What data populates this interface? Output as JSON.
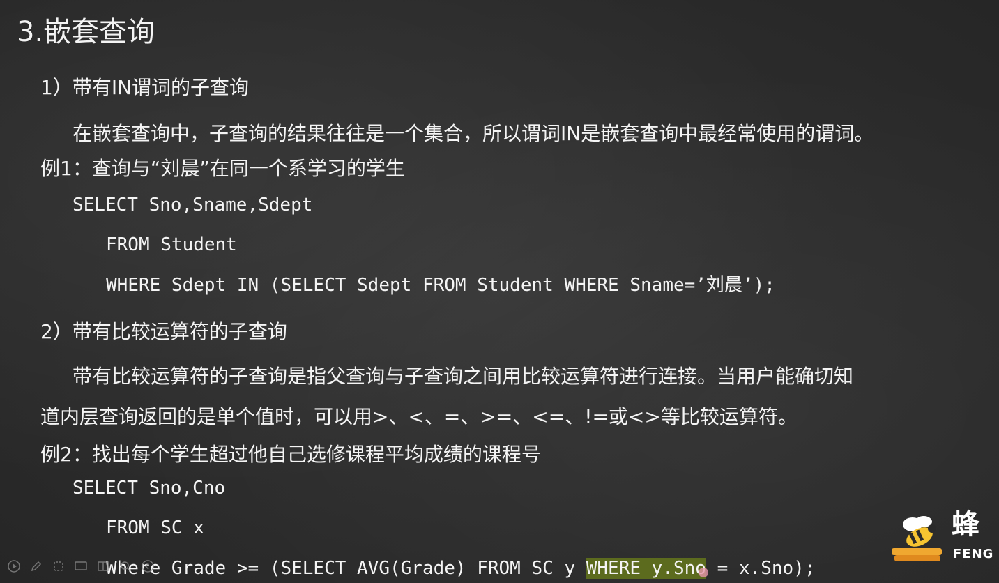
{
  "slide": {
    "title": "3.嵌套查询",
    "section1_heading": "1）带有IN谓词的子查询",
    "section1_desc": "在嵌套查询中，子查询的结果往往是一个集合，所以谓词IN是嵌套查询中最经常使用的谓词。",
    "example1_title": "例1：查询与“刘晨”在同一个系学习的学生",
    "example1_code": [
      "SELECT Sno,Sname,Sdept",
      "FROM Student",
      "WHERE Sdept IN (SELECT Sdept FROM Student WHERE Sname=’刘晨’);"
    ],
    "section2_heading": "2）带有比较运算符的子查询",
    "section2_desc_line1": "带有比较运算符的子查询是指父查询与子查询之间用比较运算符进行连接。当用户能确切知",
    "section2_desc_line2": "道内层查询返回的是单个值时，可以用>、<、=、>=、<=、!=或<>等比较运算符。",
    "example2_title": "例2：找出每个学生超过他自己选修课程平均成绩的课程号",
    "example2_code": [
      "SELECT Sno,Cno",
      "FROM SC x"
    ],
    "example2_line3_before": "Where Grade >= (SELECT AVG(Grade) FROM SC y ",
    "example2_line3_highlight": "WHERE y.Sno",
    "example2_line3_after": " = x.Sno);"
  },
  "logo": {
    "cn": "蜂",
    "en": "FENG"
  },
  "player_controls": {
    "icons": [
      "play-icon",
      "pen-icon",
      "pointer-icon",
      "screen-icon",
      "grid-icon",
      "zoom-icon",
      "more-icon"
    ]
  },
  "colors": {
    "background": "#2a2a2a",
    "text": "#f4f4f4",
    "highlight": "#5c6b1e"
  }
}
